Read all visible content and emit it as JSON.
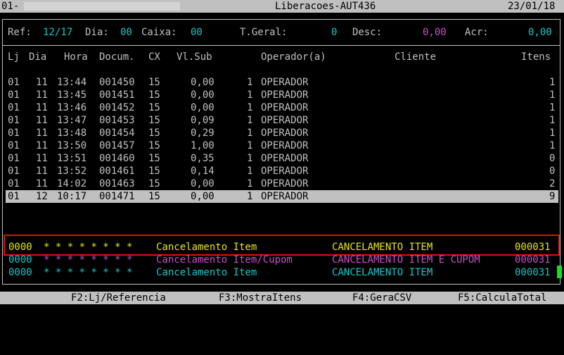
{
  "title_bar": {
    "left": "01-",
    "center": "Liberacoes-AUT436",
    "date": "23/01/18"
  },
  "summary": {
    "ref_label": "Ref:",
    "ref_value": "12/17",
    "dia_label": "Dia:",
    "dia_value": "00",
    "caixa_label": "Caixa:",
    "caixa_value": "00",
    "tgeral_label": "T.Geral:",
    "tgeral_value": "0",
    "desc_label": "Desc:",
    "desc_value": "0,00",
    "acr_label": "Acr:",
    "acr_value": "0,00"
  },
  "table": {
    "headers": {
      "lj": "Lj",
      "dia": "Dia",
      "hora": "Hora",
      "docum": "Docum.",
      "cx": "CX",
      "vlsub": "Vl.Sub",
      "operador": "Operador(a)",
      "cliente": "Cliente",
      "itens": "Itens"
    },
    "rows": [
      {
        "lj": "01",
        "dia": "11",
        "hora": "13:44",
        "doc": "001450",
        "cx": "15",
        "vl": "0,00",
        "n": "1",
        "op": "OPERADOR",
        "itens": "1"
      },
      {
        "lj": "01",
        "dia": "11",
        "hora": "13:45",
        "doc": "001451",
        "cx": "15",
        "vl": "0,00",
        "n": "1",
        "op": "OPERADOR",
        "itens": "1"
      },
      {
        "lj": "01",
        "dia": "11",
        "hora": "13:46",
        "doc": "001452",
        "cx": "15",
        "vl": "0,00",
        "n": "1",
        "op": "OPERADOR",
        "itens": "1"
      },
      {
        "lj": "01",
        "dia": "11",
        "hora": "13:47",
        "doc": "001453",
        "cx": "15",
        "vl": "0,09",
        "n": "1",
        "op": "OPERADOR",
        "itens": "1"
      },
      {
        "lj": "01",
        "dia": "11",
        "hora": "13:48",
        "doc": "001454",
        "cx": "15",
        "vl": "0,29",
        "n": "1",
        "op": "OPERADOR",
        "itens": "1"
      },
      {
        "lj": "01",
        "dia": "11",
        "hora": "13:50",
        "doc": "001457",
        "cx": "15",
        "vl": "1,00",
        "n": "1",
        "op": "OPERADOR",
        "itens": "1"
      },
      {
        "lj": "01",
        "dia": "11",
        "hora": "13:51",
        "doc": "001460",
        "cx": "15",
        "vl": "0,35",
        "n": "1",
        "op": "OPERADOR",
        "itens": "0"
      },
      {
        "lj": "01",
        "dia": "11",
        "hora": "13:52",
        "doc": "001461",
        "cx": "15",
        "vl": "0,14",
        "n": "1",
        "op": "OPERADOR",
        "itens": "0"
      },
      {
        "lj": "01",
        "dia": "11",
        "hora": "14:02",
        "doc": "001463",
        "cx": "15",
        "vl": "0,00",
        "n": "1",
        "op": "OPERADOR",
        "itens": "2"
      },
      {
        "lj": "01",
        "dia": "12",
        "hora": "10:17",
        "doc": "001471",
        "cx": "15",
        "vl": "0,00",
        "n": "1",
        "op": "OPERADOR",
        "itens": "9"
      }
    ]
  },
  "log_entries": [
    {
      "code": "0000",
      "stars": "* * * * * * * *",
      "desc": "Cancelamento Item",
      "type": "CANCELAMENTO ITEM",
      "num": "000031",
      "color": "#e6e614"
    },
    {
      "code": "0000",
      "stars": "* * * * * * * *",
      "desc": "Cancelamento Item/Cupom",
      "type": "CANCELAMENTO ITEM E CUPOM",
      "num": "000031",
      "color": "#c850c8"
    },
    {
      "code": "0000",
      "stars": "* * * * * * * *",
      "desc": "Cancelamento Item",
      "type": "CANCELAMENTO ITEM",
      "num": "000031",
      "color": "#14c8c8"
    }
  ],
  "function_keys": {
    "f2": "F2:Lj/Referencia",
    "f3": "F3:MostraItens",
    "f4": "F4:GeraCSV",
    "f5": "F5:CalculaTotal"
  },
  "colors": {
    "background": "#000000",
    "text": "#c0c0c0",
    "cyan": "#14c8c8",
    "magenta": "#c850c8",
    "yellow": "#e6e614",
    "selection": "#c0c0c0",
    "highlight_border": "#e01010",
    "cursor": "#18e018"
  }
}
